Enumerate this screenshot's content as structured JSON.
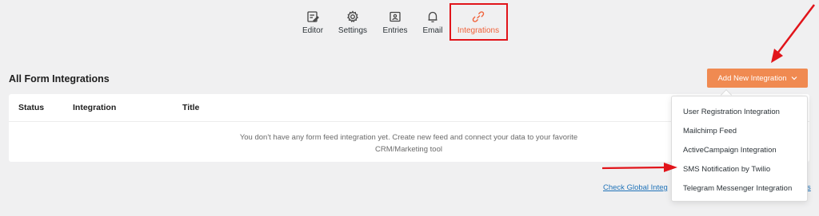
{
  "nav": {
    "items": [
      {
        "label": "Editor",
        "icon": "editor-icon"
      },
      {
        "label": "Settings",
        "icon": "gear-icon"
      },
      {
        "label": "Entries",
        "icon": "entries-icon"
      },
      {
        "label": "Email",
        "icon": "bell-icon"
      },
      {
        "label": "Integrations",
        "icon": "link-icon",
        "active": true
      }
    ]
  },
  "page": {
    "title": "All Form Integrations",
    "add_button": "Add New Integration"
  },
  "table": {
    "columns": [
      "Status",
      "Integration",
      "Title"
    ],
    "empty_message_line1": "You don't have any form feed integration yet. Create new feed and connect your data to your favorite",
    "empty_message_line2": "CRM/Marketing tool"
  },
  "dropdown": {
    "items": [
      "User Registration Integration",
      "Mailchimp Feed",
      "ActiveCampaign Integration",
      "SMS Notification by Twilio",
      "Telegram Messenger Integration"
    ]
  },
  "footer": {
    "global_link": "Check Global Integ",
    "global_link_tail": "s"
  },
  "colors": {
    "accent": "#f08a51",
    "active_nav": "#f0623a",
    "annotation_red": "#e1141a",
    "link": "#1f72b8"
  }
}
